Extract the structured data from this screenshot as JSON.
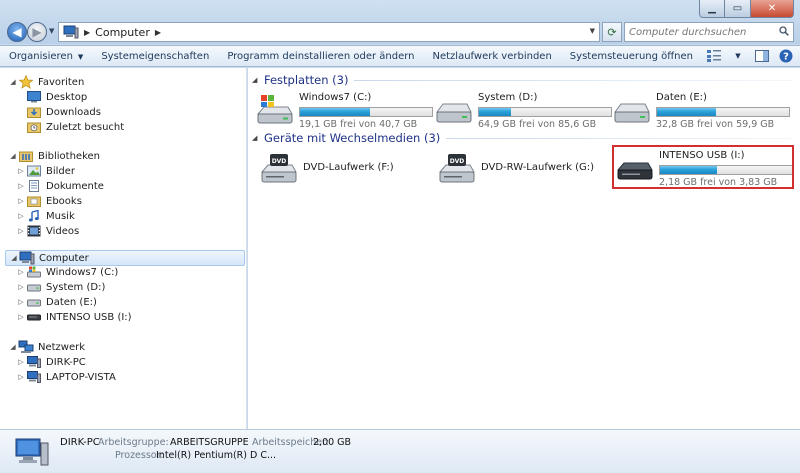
{
  "address": {
    "crumb": "Computer"
  },
  "search": {
    "placeholder": "Computer durchsuchen"
  },
  "toolbar": {
    "organize": "Organisieren",
    "system_properties": "Systemeigenschaften",
    "uninstall": "Programm deinstallieren oder ändern",
    "map_drive": "Netzlaufwerk verbinden",
    "control_panel": "Systemsteuerung öffnen"
  },
  "nav": {
    "favorites": {
      "label": "Favoriten",
      "items": [
        "Desktop",
        "Downloads",
        "Zuletzt besucht"
      ]
    },
    "libraries": {
      "label": "Bibliotheken",
      "items": [
        "Bilder",
        "Dokumente",
        "Ebooks",
        "Musik",
        "Videos"
      ]
    },
    "computer": {
      "label": "Computer",
      "items": [
        "Windows7 (C:)",
        "System (D:)",
        "Daten (E:)",
        "INTENSO USB (I:)"
      ]
    },
    "network": {
      "label": "Netzwerk",
      "items": [
        "DIRK-PC",
        "LAPTOP-VISTA"
      ]
    }
  },
  "groups": {
    "hdd": {
      "title": "Festplatten (3)"
    },
    "removable": {
      "title": "Geräte mit Wechselmedien (3)"
    }
  },
  "drives": [
    {
      "name": "Windows7 (C:)",
      "info": "19,1 GB frei von 40,7 GB",
      "used_fraction": 0.53
    },
    {
      "name": "System (D:)",
      "info": "64,9 GB frei von 85,6 GB",
      "used_fraction": 0.24
    },
    {
      "name": "Daten (E:)",
      "info": "32,8 GB frei von 59,9 GB",
      "used_fraction": 0.45
    }
  ],
  "removable": [
    {
      "name": "DVD-Laufwerk (F:)"
    },
    {
      "name": "DVD-RW-Laufwerk (G:)"
    },
    {
      "name": "INTENSO USB (I:)",
      "info": "2,18 GB frei von 3,83 GB",
      "used_fraction": 0.43
    }
  ],
  "details": {
    "name": "DIRK-PC",
    "workgroup_label": "Arbeitsgruppe:",
    "workgroup": "ARBEITSGRUPPE",
    "memory_label": "Arbeitsspeicher:",
    "memory": "2,00 GB",
    "processor_label": "Prozessor:",
    "processor": "Intel(R) Pentium(R) D C..."
  },
  "colors": {
    "accent": "#1e3287",
    "highlight": "#d22f2f",
    "bar": "#2aa0d9"
  }
}
